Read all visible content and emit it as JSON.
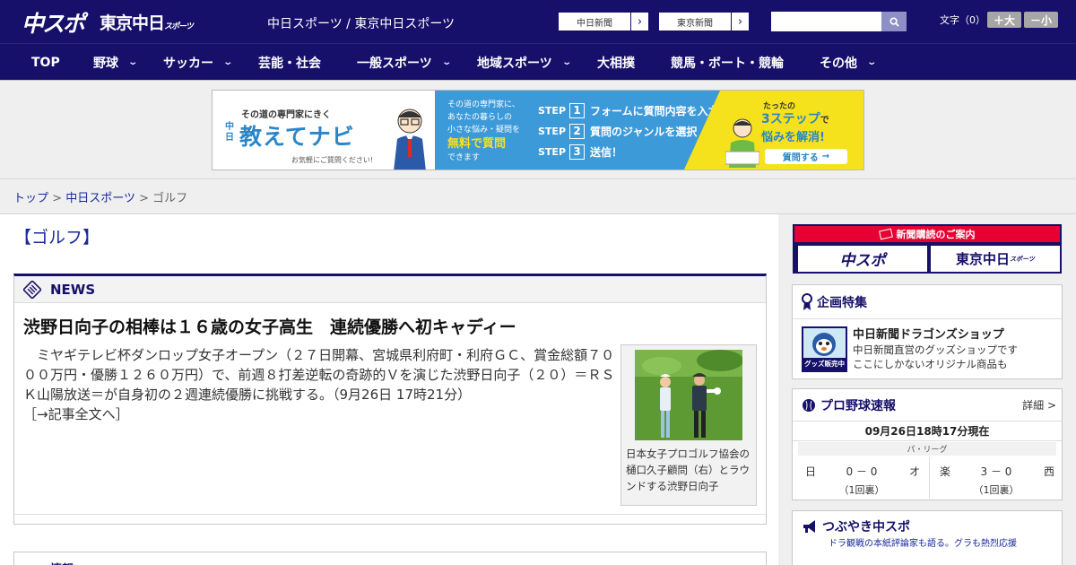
{
  "header": {
    "logo_chuspo": "中スポ",
    "logo_tokyo": "東京中日",
    "logo_tokyo_suffix": "スポーツ",
    "site_names": "中日スポーツ / 東京中日スポーツ",
    "site_btn_1": "中日新聞",
    "site_btn_2": "東京新聞",
    "search_placeholder": "",
    "search_icon": "search-icon",
    "font_size_label": "文字（0）",
    "font_larger": "＋大",
    "font_smaller": "－小"
  },
  "nav": {
    "items": [
      {
        "label": "TOP"
      },
      {
        "label": "野球"
      },
      {
        "label": "サッカー"
      },
      {
        "label": "芸能・社会"
      },
      {
        "label": "一般スポーツ"
      },
      {
        "label": "地域スポーツ"
      },
      {
        "label": "大相撲"
      },
      {
        "label": "競馬・ボート・競輪"
      },
      {
        "label": "その他"
      }
    ]
  },
  "banner": {
    "tagline": "その道の専門家にきく",
    "brand_prefix": "中日",
    "brand": "教えてナビ",
    "note": "お気軽にご質問ください!",
    "mid_text_1": "その道の専門家に、",
    "mid_text_2": "あなたの暮らしの",
    "mid_text_3": "小さな悩み・疑問を",
    "mid_free": "無料で質問",
    "mid_text_4": "できます",
    "step_word": "STEP",
    "step1_num": "1",
    "step1": "フォームに質問内容を入力",
    "step2_num": "2",
    "step2": "質問のジャンルを選択",
    "step3_num": "3",
    "step3": "送信！",
    "right_1": "たったの",
    "right_2": "3ステップ",
    "right_2b": "で",
    "right_3": "悩みを解消!",
    "cta": "質問する"
  },
  "breadcrumb": {
    "home": "トップ",
    "sep": ">",
    "section": "中日スポーツ",
    "current": "ゴルフ"
  },
  "main": {
    "category_title": "【ゴルフ】",
    "news_label": "NEWS",
    "headline": "渋野日向子の相棒は１６歳の女子高生　連続優勝へ初キャディー",
    "body": "　ミヤギテレビ杯ダンロップ女子オープン（２７日開幕、宮城県利府町・利府ＧＣ、賞金総額７０００万円・優勝１２６０万円）で、前週８打差逆転の奇跡的Ｖを演じた渋野日向子（２０）＝ＲＳＫ山陽放送＝が自身初の２週連続優勝に挑戦する。（9月26日 17時21分）",
    "read_more": "［→記事全文へ］",
    "photo_caption": "日本女子プロゴルフ協会の樋口久子顧問（右）とラウンドする渋野日向子",
    "second_panel_label": "情報"
  },
  "sidebar": {
    "subscribe_title": "新聞購読のご案内",
    "subscribe_btn_1": "中スポ",
    "subscribe_btn_2": "東京中日",
    "subscribe_btn_2_suffix": "スポーツ",
    "feature_title": "企画特集",
    "shop_badge": "グッズ販売中",
    "shop_name": "中日新聞ドラゴンズショップ",
    "shop_desc_1": "中日新聞直営のグッズショップです",
    "shop_desc_2": "ここにしかないオリジナル商品も",
    "baseball_title": "プロ野球速報",
    "baseball_more": "詳細 >",
    "baseball_time": "09月26日18時17分現在",
    "league": "パ・リーグ",
    "games": [
      {
        "team1": "日",
        "score": "0 － 0",
        "team2": "オ",
        "inning": "（1回裏）"
      },
      {
        "team1": "楽",
        "score": "3 － 0",
        "team2": "西",
        "inning": "（1回裏）"
      }
    ],
    "tweet_title": "つぶやき中スポ",
    "tweet_sub": "ドラ観戦の本紙評論家も語る。グラも熱烈応援"
  }
}
